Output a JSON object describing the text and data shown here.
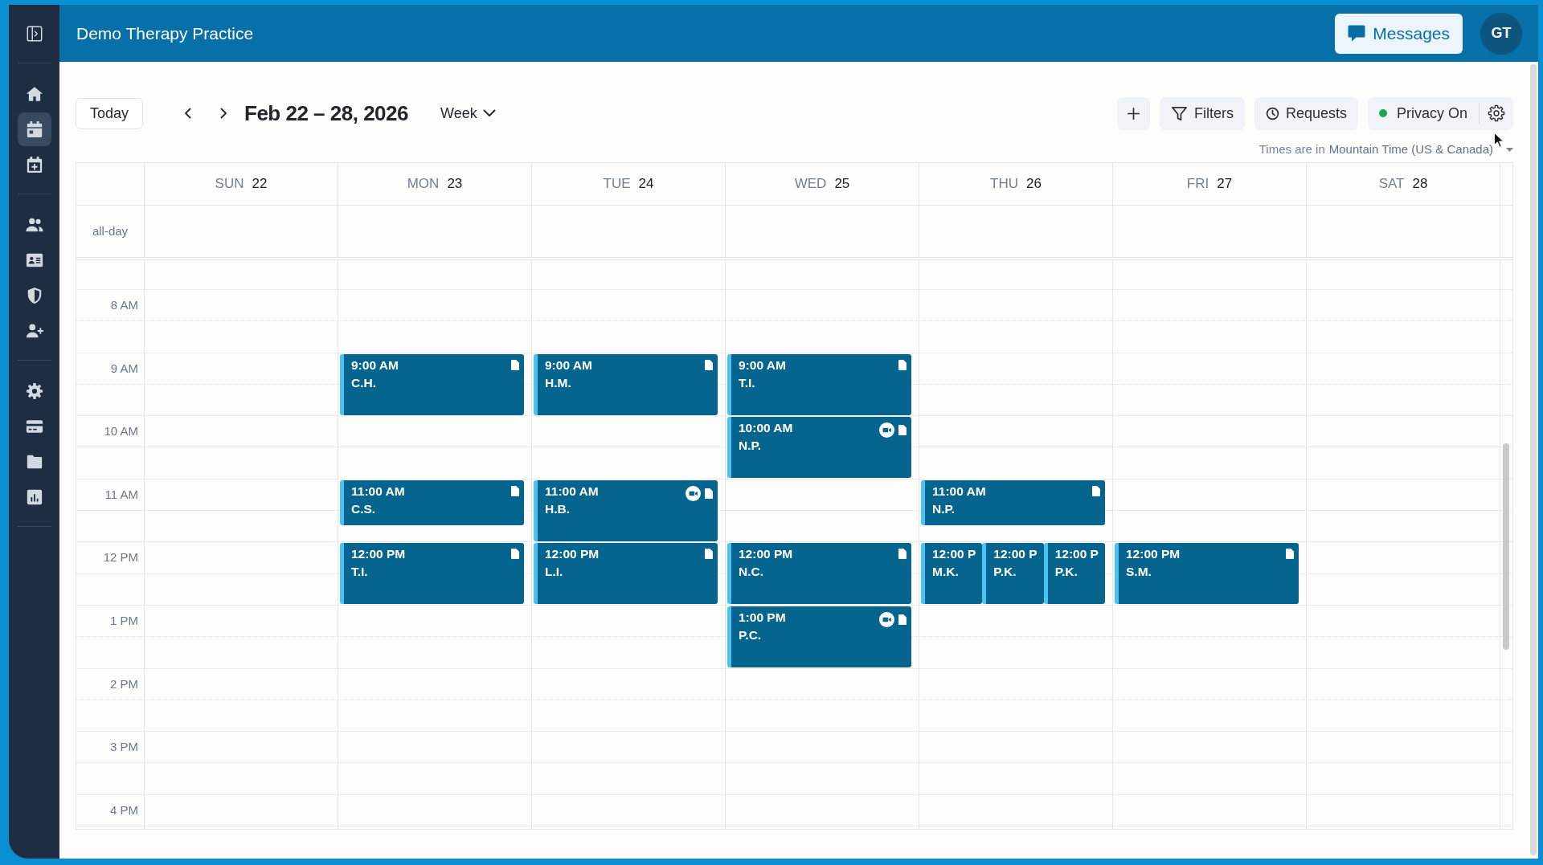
{
  "sidebar": {
    "sections": [
      {
        "items": [
          {
            "kind": "home",
            "selected": false
          },
          {
            "kind": "calendar",
            "selected": true
          },
          {
            "kind": "calendar-plus",
            "selected": false
          }
        ]
      },
      {
        "items": [
          {
            "kind": "people",
            "selected": false
          },
          {
            "kind": "id-card",
            "selected": false
          },
          {
            "kind": "shield",
            "selected": false
          },
          {
            "kind": "user-plus",
            "selected": false
          }
        ]
      },
      {
        "items": [
          {
            "kind": "gear",
            "selected": false
          },
          {
            "kind": "card",
            "selected": false
          },
          {
            "kind": "folder",
            "selected": false
          },
          {
            "kind": "chart",
            "selected": false
          }
        ]
      }
    ]
  },
  "header": {
    "title": "Demo Therapy Practice",
    "messages_button": "Messages",
    "avatar_initials": "GT"
  },
  "toolbar": {
    "today_button": "Today",
    "date_range": "Feb 22 – 28, 2026",
    "view": "Week",
    "filters_button": "Filters",
    "requests_button": "Requests",
    "privacy": {
      "label": "Privacy On",
      "on": true
    }
  },
  "timezone": {
    "prefix": "Times are in",
    "zone": "Mountain Time (US & Canada)"
  },
  "calendar": {
    "all_day_label": "all-day",
    "hours": [
      "8 AM",
      "9 AM",
      "10 AM",
      "11 AM",
      "12 PM",
      "1 PM",
      "2 PM",
      "3 PM",
      "4 PM"
    ],
    "days": [
      {
        "name": "SUN",
        "date": "22"
      },
      {
        "name": "MON",
        "date": "23",
        "events": [
          {
            "time": "9:00 AM",
            "client": "C.H.",
            "kind": "hour",
            "video": false,
            "note": true
          },
          {
            "time": "11:00 AM",
            "client": "C.S.",
            "kind": "short",
            "video": false,
            "note": true
          },
          {
            "time": "12:00 PM",
            "client": "T.I.",
            "kind": "hour",
            "video": false,
            "note": true
          }
        ]
      },
      {
        "name": "TUE",
        "date": "24",
        "events": [
          {
            "time": "9:00 AM",
            "client": "H.M.",
            "kind": "hour",
            "video": false,
            "note": true
          },
          {
            "time": "11:00 AM",
            "client": "H.B.",
            "kind": "hour",
            "video": true,
            "note": true
          },
          {
            "time": "12:00 PM",
            "client": "L.I.",
            "kind": "hour",
            "video": false,
            "note": true
          }
        ]
      },
      {
        "name": "WED",
        "date": "25",
        "events": [
          {
            "time": "9:00 AM",
            "client": "T.I.",
            "kind": "hour",
            "video": false,
            "note": true
          },
          {
            "time": "10:00 AM",
            "client": "N.P.",
            "kind": "hour",
            "video": true,
            "note": true
          },
          {
            "time": "12:00 PM",
            "client": "N.C.",
            "kind": "hour",
            "video": false,
            "note": true
          },
          {
            "time": "1:00 PM",
            "client": "P.C.",
            "kind": "hour",
            "video": true,
            "note": true
          }
        ]
      },
      {
        "name": "THU",
        "date": "26",
        "events": [
          {
            "time": "11:00 AM",
            "client": "N.P.",
            "kind": "short",
            "video": false,
            "note": true
          },
          {
            "time": "12:00 P",
            "client": "M.K.",
            "kind": "hour",
            "video": false,
            "note": false
          },
          {
            "time": "12:00 P",
            "client": "P.K.",
            "kind": "hour",
            "video": false,
            "note": false
          },
          {
            "time": "12:00 P",
            "client": "P.K.",
            "kind": "hour",
            "video": false,
            "note": false
          }
        ]
      },
      {
        "name": "FRI",
        "date": "27",
        "events": [
          {
            "time": "12:00 PM",
            "client": "S.M.",
            "kind": "hour",
            "video": false,
            "note": true
          }
        ]
      },
      {
        "name": "SAT",
        "date": "28"
      }
    ]
  }
}
